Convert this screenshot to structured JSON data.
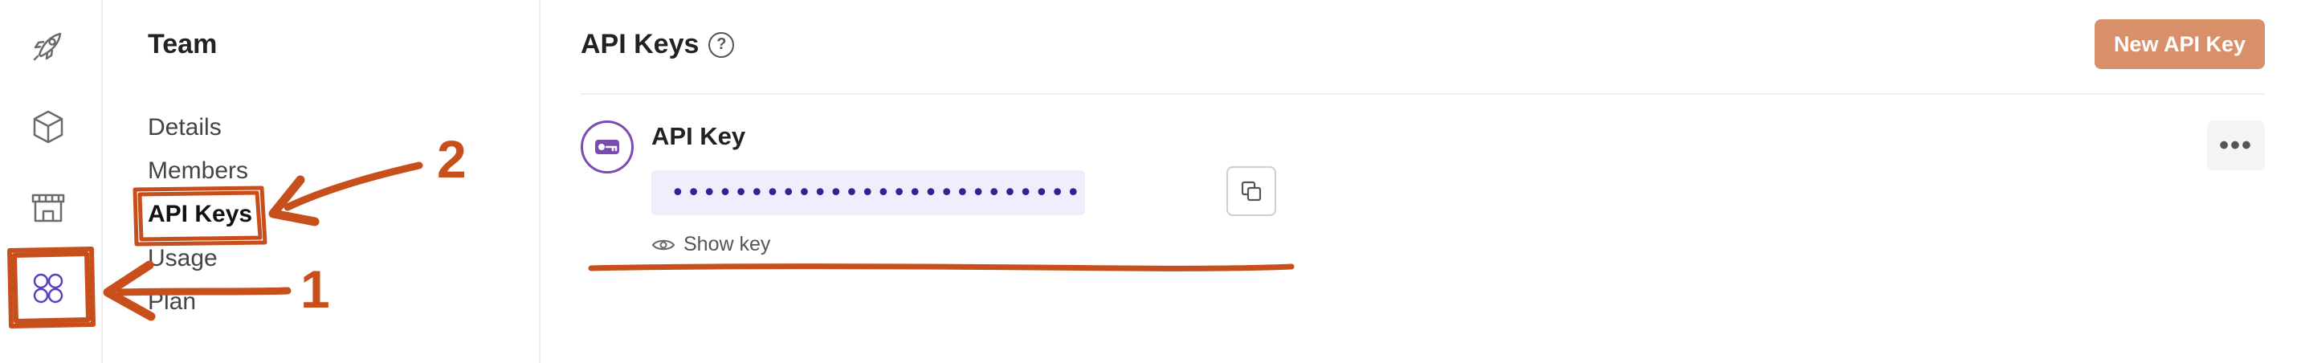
{
  "rail": {
    "items": [
      {
        "icon": "rocket-icon"
      },
      {
        "icon": "cube-icon"
      },
      {
        "icon": "store-icon"
      },
      {
        "icon": "apps-grid-icon"
      }
    ]
  },
  "subnav": {
    "title": "Team",
    "items": [
      {
        "label": "Details"
      },
      {
        "label": "Members"
      },
      {
        "label": "API Keys"
      },
      {
        "label": "Usage"
      },
      {
        "label": "Plan"
      }
    ]
  },
  "main": {
    "title": "API Keys",
    "help_glyph": "?",
    "new_button": "New API Key",
    "key": {
      "name": "API Key",
      "masked_value": "••••••••••••••••••••••••••••••••",
      "show_label": "Show key",
      "more_glyph": "•••"
    }
  },
  "annotations": {
    "step_1": "1",
    "step_2": "2",
    "color": "#c74f1c"
  },
  "colors": {
    "accent_button": "#d9906a",
    "key_avatar": "#7b4bb3",
    "active_rail_icon": "#5b3fbf"
  }
}
